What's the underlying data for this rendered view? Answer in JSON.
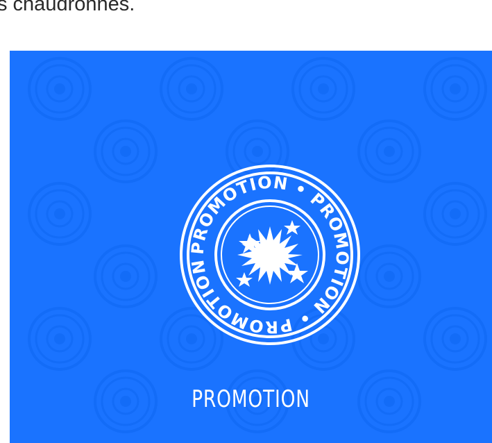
{
  "page_text": "s chaudronnes.",
  "card": {
    "background": "#1a73ff",
    "title": "PROMOTION",
    "badge": {
      "icon": "promotion-stamp-icon",
      "ring_text": "PROMOTION • PROMOTION • PROMOTION •"
    },
    "pattern_icon": "promotion-stamp-icon"
  }
}
